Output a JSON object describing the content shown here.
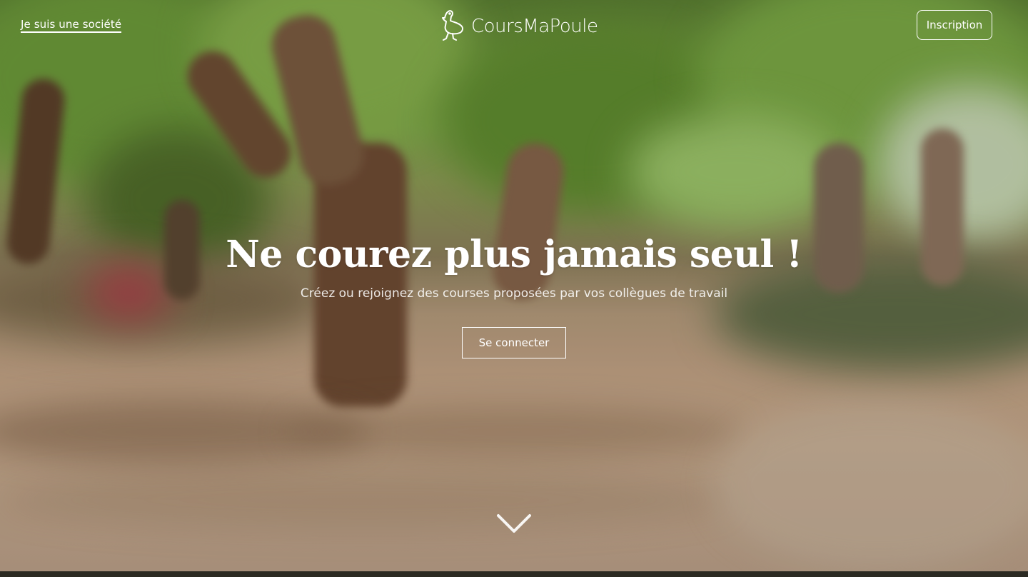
{
  "header": {
    "company_link": "Je suis une société",
    "logo_text": "CoursMaPoule",
    "signup_label": "Inscription"
  },
  "hero": {
    "headline": "Ne courez plus jamais seul !",
    "subtitle": "Créez ou rejoignez des courses proposées par vos collègues de travail",
    "login_label": "Se connecter"
  },
  "icons": {
    "logo": "chicken-icon",
    "scroll": "chevron-down-icon"
  },
  "colors": {
    "text": "#ffffff",
    "foliage": "#6f9a3d",
    "path": "#c6a88c"
  }
}
